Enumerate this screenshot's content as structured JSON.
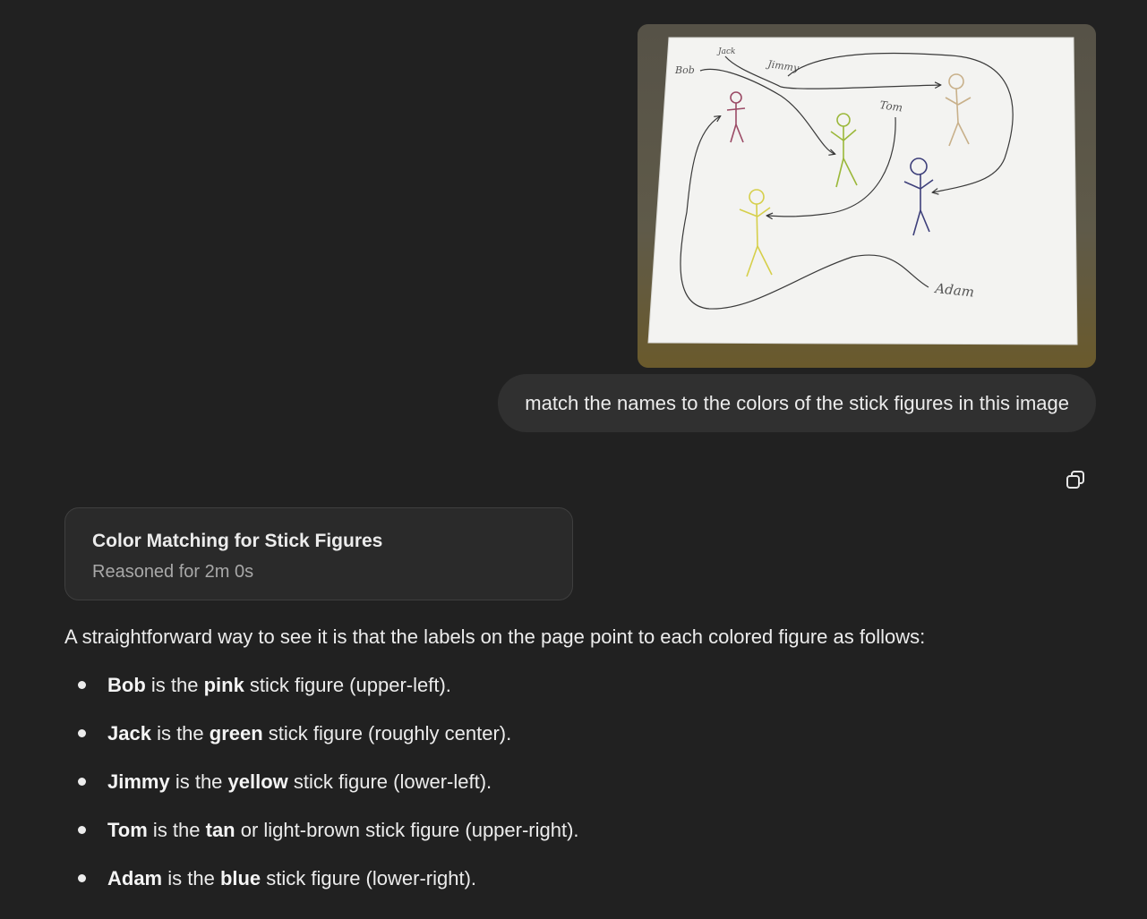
{
  "user_message": {
    "text": "match the names to the colors of the stick figures in this image",
    "image": {
      "labels": [
        "Bob",
        "Jack",
        "Jimmy",
        "Tom",
        "Adam"
      ],
      "figure_colors": {
        "pink": "#9b4b66",
        "green": "#9bb83a",
        "yellow": "#d6cf4a",
        "tan": "#c8b08a",
        "blue": "#3d3f7a"
      }
    }
  },
  "toolbar": {
    "copy_icon": "copy-icon"
  },
  "reasoning": {
    "title": "Color Matching for Stick Figures",
    "subtitle": "Reasoned for 2m 0s"
  },
  "answer": {
    "intro": "A straightforward way to see it is that the labels on the page point to each colored figure as follows:",
    "items": [
      {
        "name": "Bob",
        "mid": " is the ",
        "color": "pink",
        "rest": " stick figure (upper-left)."
      },
      {
        "name": "Jack",
        "mid": " is the ",
        "color": "green",
        "rest": " stick figure (roughly center)."
      },
      {
        "name": "Jimmy",
        "mid": " is the ",
        "color": "yellow",
        "rest": " stick figure (lower-left)."
      },
      {
        "name": "Tom",
        "mid": " is the ",
        "color": "tan",
        "rest": " or light-brown stick figure (upper-right)."
      },
      {
        "name": "Adam",
        "mid": " is the ",
        "color": "blue",
        "rest": " stick figure (lower-right)."
      }
    ]
  },
  "theme": {
    "background": "#212121",
    "bubble": "#303030",
    "text": "#ececec",
    "muted": "#a8a8a8"
  }
}
